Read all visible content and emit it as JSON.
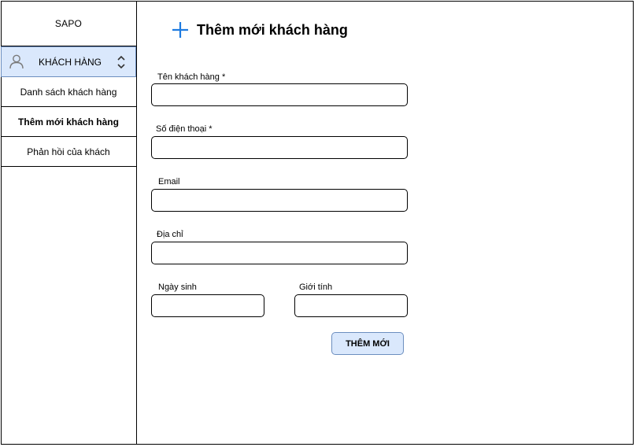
{
  "sidebar": {
    "brand": "SAPO",
    "section": {
      "label": "KHÁCH HÀNG",
      "icon": "user-icon",
      "toggle_icon": "chevron-up-down-icon"
    },
    "items": [
      {
        "label": "Danh sách khách hàng",
        "active": false
      },
      {
        "label": "Thêm mới khách hàng",
        "active": true
      },
      {
        "label": "Phản hồi của khách",
        "active": false
      }
    ]
  },
  "main": {
    "title": "Thêm mới khách hàng",
    "title_icon": "plus-icon",
    "accent_color": "#1e7be0",
    "form": {
      "name": {
        "label": "Tên khách hàng *",
        "value": "",
        "placeholder": ""
      },
      "phone": {
        "label": "Số điện thoại *",
        "value": "",
        "placeholder": ""
      },
      "email": {
        "label": "Email",
        "value": "",
        "placeholder": ""
      },
      "address": {
        "label": "Địa chỉ",
        "value": "",
        "placeholder": ""
      },
      "birthday": {
        "label": "Ngày sinh",
        "value": "",
        "placeholder": ""
      },
      "gender": {
        "label": "Giới tính",
        "value": "",
        "placeholder": ""
      },
      "submit_label": "THÊM MỚI"
    }
  },
  "colors": {
    "highlight_fill": "#dae8fc",
    "highlight_border": "#6c8ebf",
    "border": "#000000"
  }
}
